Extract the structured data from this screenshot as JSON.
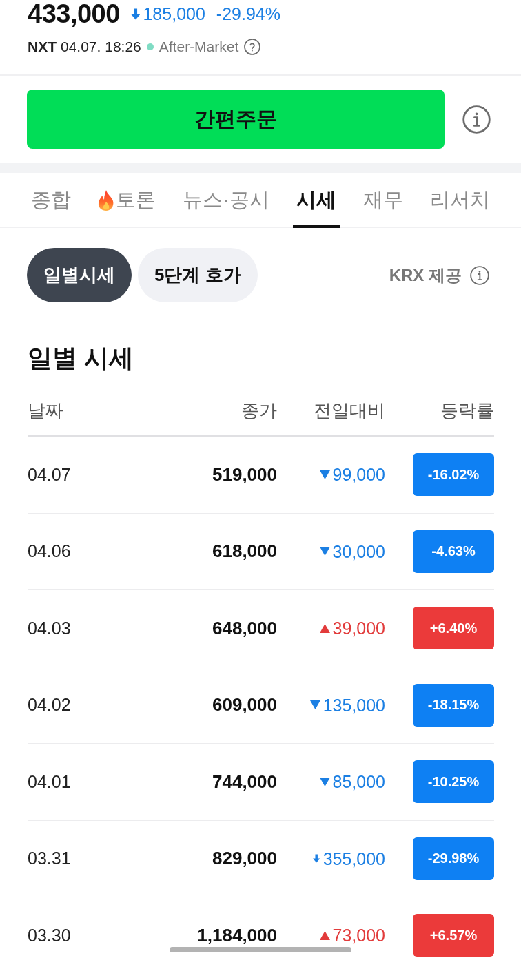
{
  "quote": {
    "price": "433,000",
    "change": {
      "value": "185,000",
      "kind": "limit_down"
    },
    "rate": "-29.94%"
  },
  "session": {
    "venue": "NXT",
    "time": "04.07. 18:26",
    "status": "After-Market"
  },
  "order_button": {
    "label": "간편주문"
  },
  "tabs": [
    {
      "label": "종합",
      "kind": "plain",
      "selected": false
    },
    {
      "label": "토론",
      "kind": "hot",
      "selected": false
    },
    {
      "label": "뉴스·공시",
      "kind": "plain",
      "selected": false
    },
    {
      "label": "시세",
      "kind": "plain",
      "selected": true
    },
    {
      "label": "재무",
      "kind": "plain",
      "selected": false
    },
    {
      "label": "리서치",
      "kind": "plain",
      "selected": false
    }
  ],
  "view_toggle": [
    {
      "label": "일별시세",
      "selected": true
    },
    {
      "label": "5단계 호가",
      "selected": false
    }
  ],
  "source": "KRX 제공",
  "section_title": "일별 시세",
  "table": {
    "columns": [
      "날짜",
      "종가",
      "전일대비",
      "등락률"
    ],
    "rows": [
      {
        "date": "04.07",
        "close": "519,000",
        "change": "99,000",
        "kind": "down",
        "rate": "-16.02%"
      },
      {
        "date": "04.06",
        "close": "618,000",
        "change": "30,000",
        "kind": "down",
        "rate": "-4.63%"
      },
      {
        "date": "04.03",
        "close": "648,000",
        "change": "39,000",
        "kind": "up",
        "rate": "+6.40%"
      },
      {
        "date": "04.02",
        "close": "609,000",
        "change": "135,000",
        "kind": "down",
        "rate": "-18.15%"
      },
      {
        "date": "04.01",
        "close": "744,000",
        "change": "85,000",
        "kind": "down",
        "rate": "-10.25%"
      },
      {
        "date": "03.31",
        "close": "829,000",
        "change": "355,000",
        "kind": "limit_down",
        "rate": "-29.98%"
      },
      {
        "date": "03.30",
        "close": "1,184,000",
        "change": "73,000",
        "kind": "up",
        "rate": "+6.57%"
      }
    ]
  }
}
